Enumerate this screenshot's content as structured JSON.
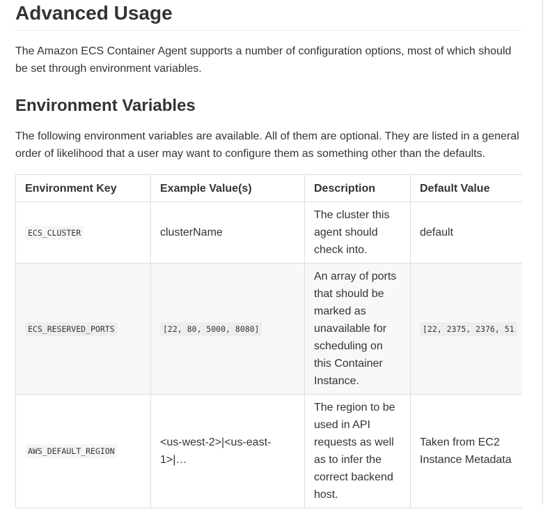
{
  "title": "Advanced Usage",
  "intro": "The Amazon ECS Container Agent supports a number of configuration options, most of which should be set through environment variables.",
  "section_title": "Environment Variables",
  "section_text": "The following environment variables are available. All of them are optional. They are listed in a general order of likelihood that a user may want to configure them as something other than the defaults.",
  "table": {
    "headers": [
      "Environment Key",
      "Example Value(s)",
      "Description",
      "Default Value"
    ],
    "rows": [
      {
        "key": "ECS_CLUSTER",
        "example": "clusterName",
        "description": "The cluster this agent should check into.",
        "default": "default"
      },
      {
        "key": "ECS_RESERVED_PORTS",
        "example": "[22, 80, 5000, 8080]",
        "description": "An array of ports that should be marked as unavailable for scheduling on this Container Instance.",
        "default": "[22, 2375, 2376, 51"
      },
      {
        "key": "AWS_DEFAULT_REGION",
        "example": "<us-west-2>|<us-east-1>|…",
        "description": "The region to be used in API requests as well as to infer the correct backend host.",
        "default": "Taken from EC2 Instance Metadata"
      }
    ]
  }
}
